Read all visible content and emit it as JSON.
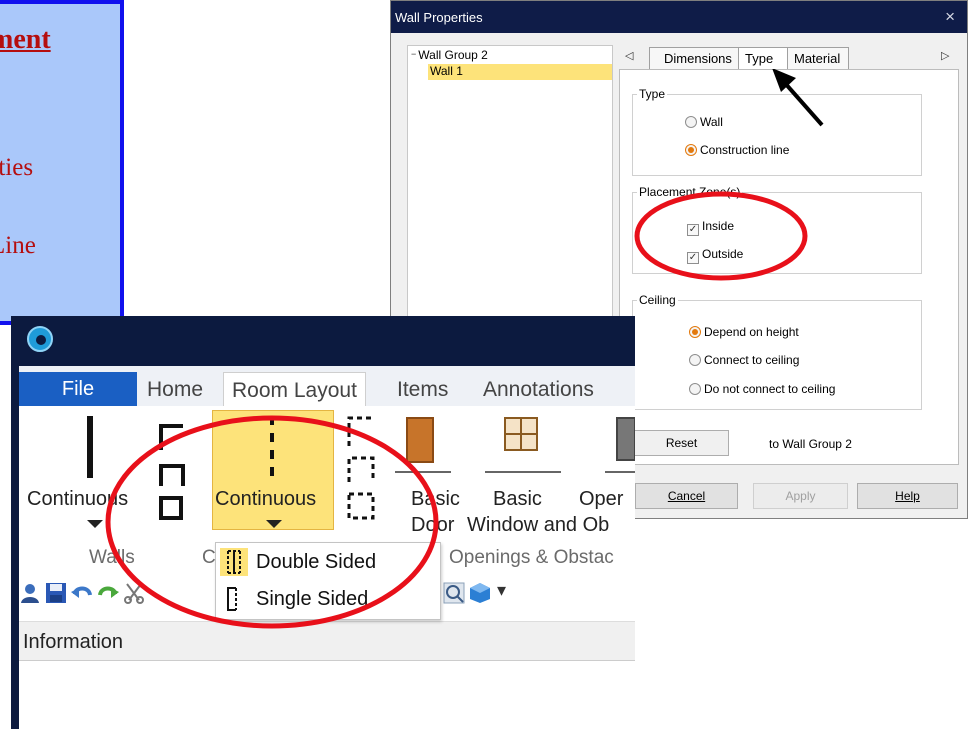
{
  "slide": {
    "title": "ment",
    "bullet": ".",
    "line2": "rties",
    "line3": "Line"
  },
  "dialog": {
    "title": "Wall Properties",
    "close": "×",
    "tree": {
      "group": "Wall Group 2",
      "item": "Wall 1"
    },
    "tabs": {
      "left_arrow": "◁",
      "right_arrow": "▷",
      "dimensions": "Dimensions",
      "type": "Type",
      "material": "Material"
    },
    "type_group": {
      "label": "Type",
      "wall": "Wall",
      "construction_line": "Construction line"
    },
    "placement_group": {
      "label": "Placement Zone(s)",
      "inside": "Inside",
      "outside": "Outside"
    },
    "ceiling_group": {
      "label": "Ceiling",
      "depend": "Depend on height",
      "connect": "Connect to ceiling",
      "no_connect": "Do not connect to ceiling"
    },
    "reset": "Reset",
    "reset_note": "to Wall Group 2",
    "cancel": "Cancel",
    "apply": "Apply",
    "help": "Help"
  },
  "app": {
    "ribbon_tabs": {
      "file": "File",
      "home": "Home",
      "room_layout": "Room Layout",
      "items": "Items",
      "annotations": "Annotations"
    },
    "ribbon": {
      "walls_continuous": "Continuous",
      "cl_continuous": "Continuous",
      "basic_door_1": "Basic",
      "basic_door_2": "Door",
      "basic_window_1": "Basic",
      "basic_window_2": "Window and Ob",
      "openings_1": "Oper",
      "group_walls": "Walls",
      "group_c": "C",
      "group_openings": "Openings & Obstac"
    },
    "dropdown": {
      "double_sided": "Double Sided",
      "single_sided": "Single Sided"
    },
    "qat_more": "▾",
    "info": "Information"
  },
  "colors": {
    "highlight": "#fde37a",
    "file_tab": "#1a5fc3",
    "annotation_red": "#e8101a",
    "slide_text": "#b50e0e"
  }
}
